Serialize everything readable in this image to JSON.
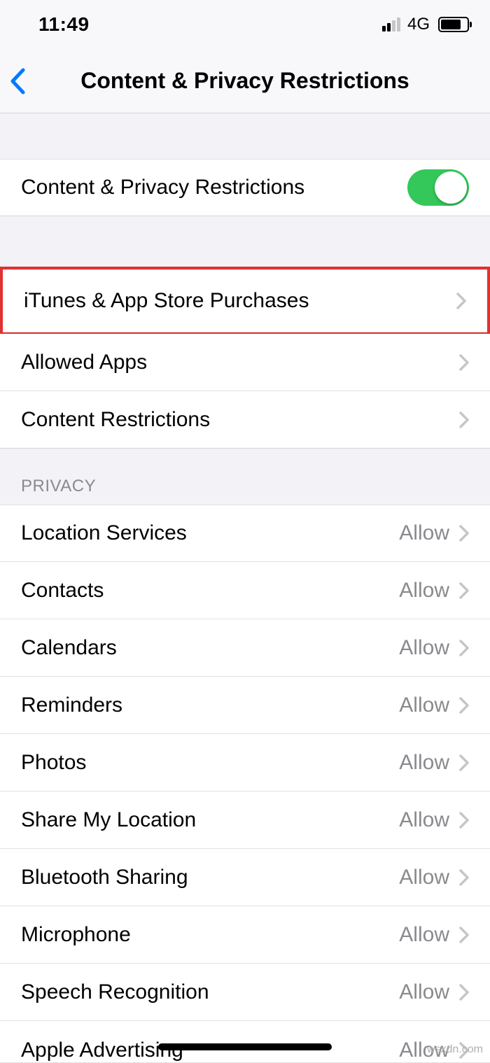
{
  "status": {
    "time": "11:49",
    "network_type": "4G"
  },
  "nav": {
    "title": "Content & Privacy Restrictions"
  },
  "toggle_row": {
    "label": "Content & Privacy Restrictions",
    "on": true
  },
  "group1": {
    "itunes": "iTunes & App Store Purchases",
    "allowed_apps": "Allowed Apps",
    "content_restrictions": "Content Restrictions"
  },
  "privacy": {
    "header": "PRIVACY",
    "items": [
      {
        "label": "Location Services",
        "value": "Allow"
      },
      {
        "label": "Contacts",
        "value": "Allow"
      },
      {
        "label": "Calendars",
        "value": "Allow"
      },
      {
        "label": "Reminders",
        "value": "Allow"
      },
      {
        "label": "Photos",
        "value": "Allow"
      },
      {
        "label": "Share My Location",
        "value": "Allow"
      },
      {
        "label": "Bluetooth Sharing",
        "value": "Allow"
      },
      {
        "label": "Microphone",
        "value": "Allow"
      },
      {
        "label": "Speech Recognition",
        "value": "Allow"
      },
      {
        "label": "Apple Advertising",
        "value": "Allow"
      }
    ]
  },
  "watermark": "wsxdn.com"
}
